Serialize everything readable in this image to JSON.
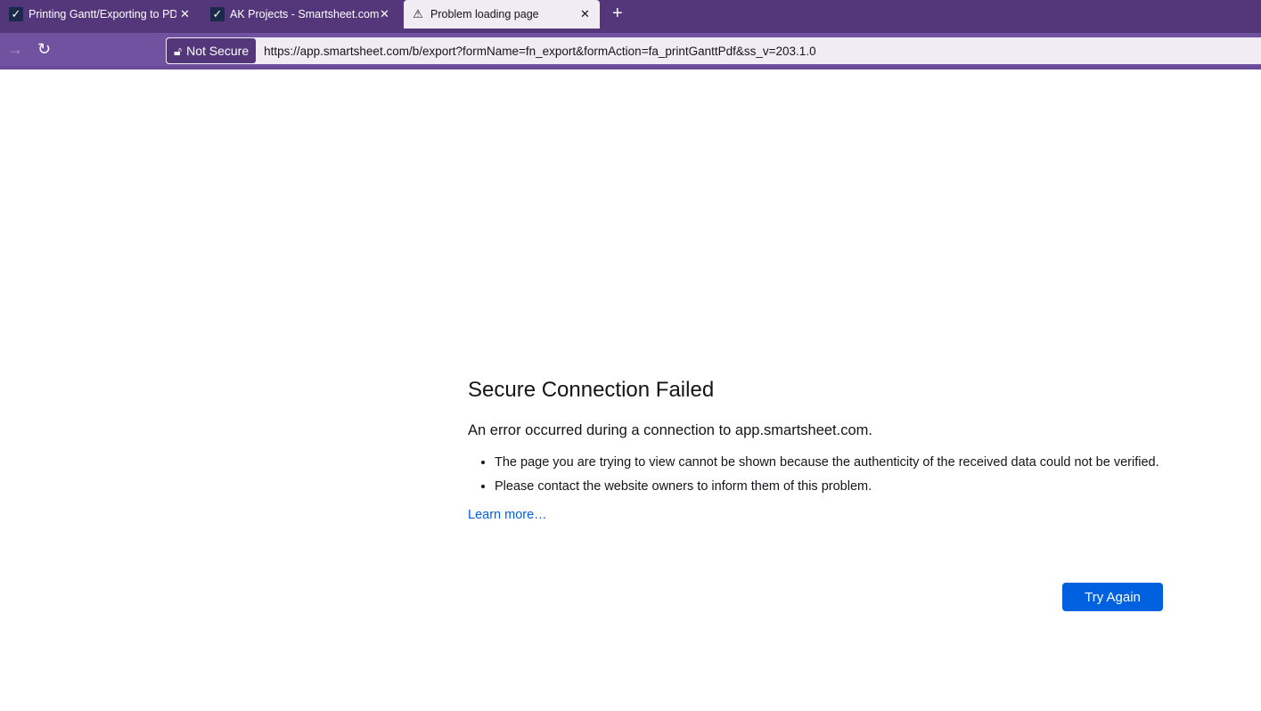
{
  "tabs": [
    {
      "title": "Printing Gantt/Exporting to PDF",
      "icon": "smartsheet-icon",
      "active": false
    },
    {
      "title": "AK Projects - Smartsheet.com",
      "icon": "smartsheet-icon",
      "active": false
    },
    {
      "title": "Problem loading page",
      "icon": "warning-icon",
      "active": true
    }
  ],
  "toolbar": {
    "security_label": "Not Secure",
    "url": "https://app.smartsheet.com/b/export?formName=fn_export&formAction=fa_printGanttPdf&ss_v=203.1.0"
  },
  "error": {
    "title": "Secure Connection Failed",
    "subtitle": "An error occurred during a connection to app.smartsheet.com.",
    "bullets": [
      "The page you are trying to view cannot be shown because the authenticity of the received data could not be verified.",
      "Please contact the website owners to inform them of this problem."
    ],
    "learn_more": "Learn more…",
    "try_again": "Try Again"
  },
  "colors": {
    "tabbar": "#54377a",
    "toolbar": "#7152a0",
    "accent": "#0061e0"
  }
}
